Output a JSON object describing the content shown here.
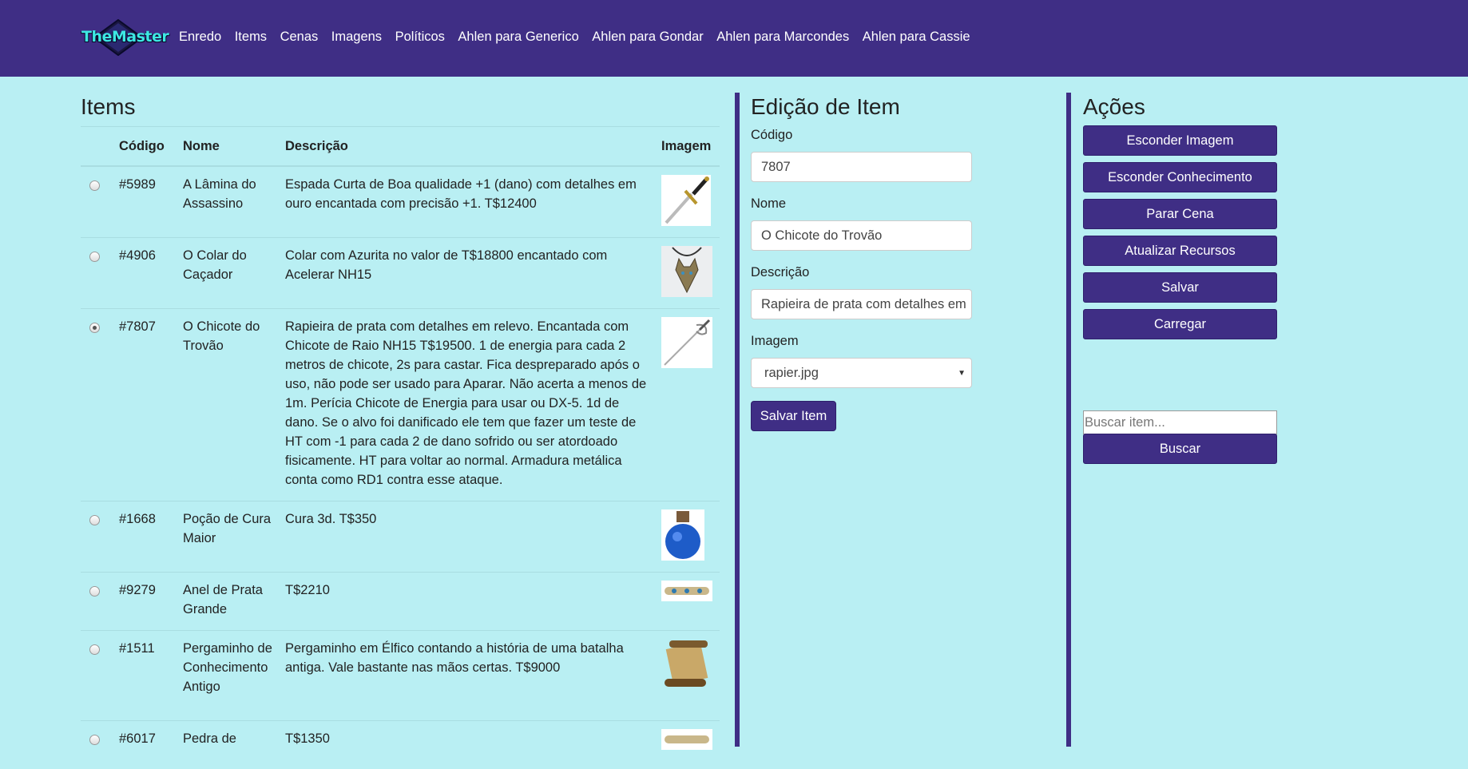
{
  "brand": {
    "logo_text": "TheMaster"
  },
  "nav": [
    {
      "label": "Enredo"
    },
    {
      "label": "Items"
    },
    {
      "label": "Cenas"
    },
    {
      "label": "Imagens"
    },
    {
      "label": "Políticos"
    },
    {
      "label": "Ahlen para Generico"
    },
    {
      "label": "Ahlen para Gondar"
    },
    {
      "label": "Ahlen para Marcondes"
    },
    {
      "label": "Ahlen para Cassie"
    }
  ],
  "items_panel": {
    "title": "Items",
    "columns": [
      "Código",
      "Nome",
      "Descrição",
      "Imagem"
    ],
    "rows": [
      {
        "code": "#5989",
        "name": "A Lâmina do Assassino",
        "description": "Espada Curta de Boa qualidade +1 (dano) com detalhes em ouro encantada com precisão +1. T$12400",
        "image": "dagger-image",
        "selected": false
      },
      {
        "code": "#4906",
        "name": "O Colar do Caçador",
        "description": "Colar com Azurita no valor de T$18800 encantado com Acelerar NH15",
        "image": "wolf-necklace-image",
        "selected": false
      },
      {
        "code": "#7807",
        "name": "O Chicote do Trovão",
        "description": "Rapieira de prata com detalhes em relevo. Encantada com Chicote de Raio NH15 T$19500. 1 de energia para cada 2 metros de chicote, 2s para castar. Fica despreparado após o uso, não pode ser usado para Aparar. Não acerta a menos de 1m. Perícia Chicote de Energia para usar ou DX-5. 1d de dano. Se o alvo foi danificado ele tem que fazer um teste de HT com -1 para cada 2 de dano sofrido ou ser atordoado fisicamente. HT para voltar ao normal. Armadura metálica conta como RD1 contra esse ataque.",
        "image": "rapier-image",
        "selected": true
      },
      {
        "code": "#1668",
        "name": "Poção de Cura Maior",
        "description": "Cura 3d. T$350",
        "image": "potion-image",
        "selected": false
      },
      {
        "code": "#9279",
        "name": "Anel de Prata Grande",
        "description": "T$2210",
        "image": "ring-image",
        "selected": false
      },
      {
        "code": "#1511",
        "name": "Pergaminho de Conhecimento Antigo",
        "description": "Pergaminho em Élfico contando a história de uma batalha antiga. Vale bastante nas mãos certas. T$9000",
        "image": "scroll-image",
        "selected": false
      },
      {
        "code": "#6017",
        "name": "Pedra de",
        "description": "T$1350",
        "image": "stone-image",
        "selected": false
      }
    ]
  },
  "edit_panel": {
    "title": "Edição de Item",
    "code_label": "Código",
    "code_value": "7807",
    "name_label": "Nome",
    "name_value": "O Chicote do Trovão",
    "description_label": "Descrição",
    "description_value": "Rapieira de prata com detalhes em",
    "image_label": "Imagem",
    "image_value": "rapier.jpg",
    "save_label": "Salvar Item"
  },
  "actions_panel": {
    "title": "Ações",
    "buttons": [
      {
        "label": "Esconder Imagem"
      },
      {
        "label": "Esconder Conhecimento"
      },
      {
        "label": "Parar Cena"
      },
      {
        "label": "Atualizar Recursos"
      },
      {
        "label": "Salvar"
      },
      {
        "label": "Carregar"
      }
    ],
    "search_placeholder": "Buscar item...",
    "search_button": "Buscar"
  },
  "colors": {
    "navbar": "#3f2e85",
    "background": "#b9eff3",
    "button": "#3f2e85",
    "logo_text": "#3de8e3"
  }
}
